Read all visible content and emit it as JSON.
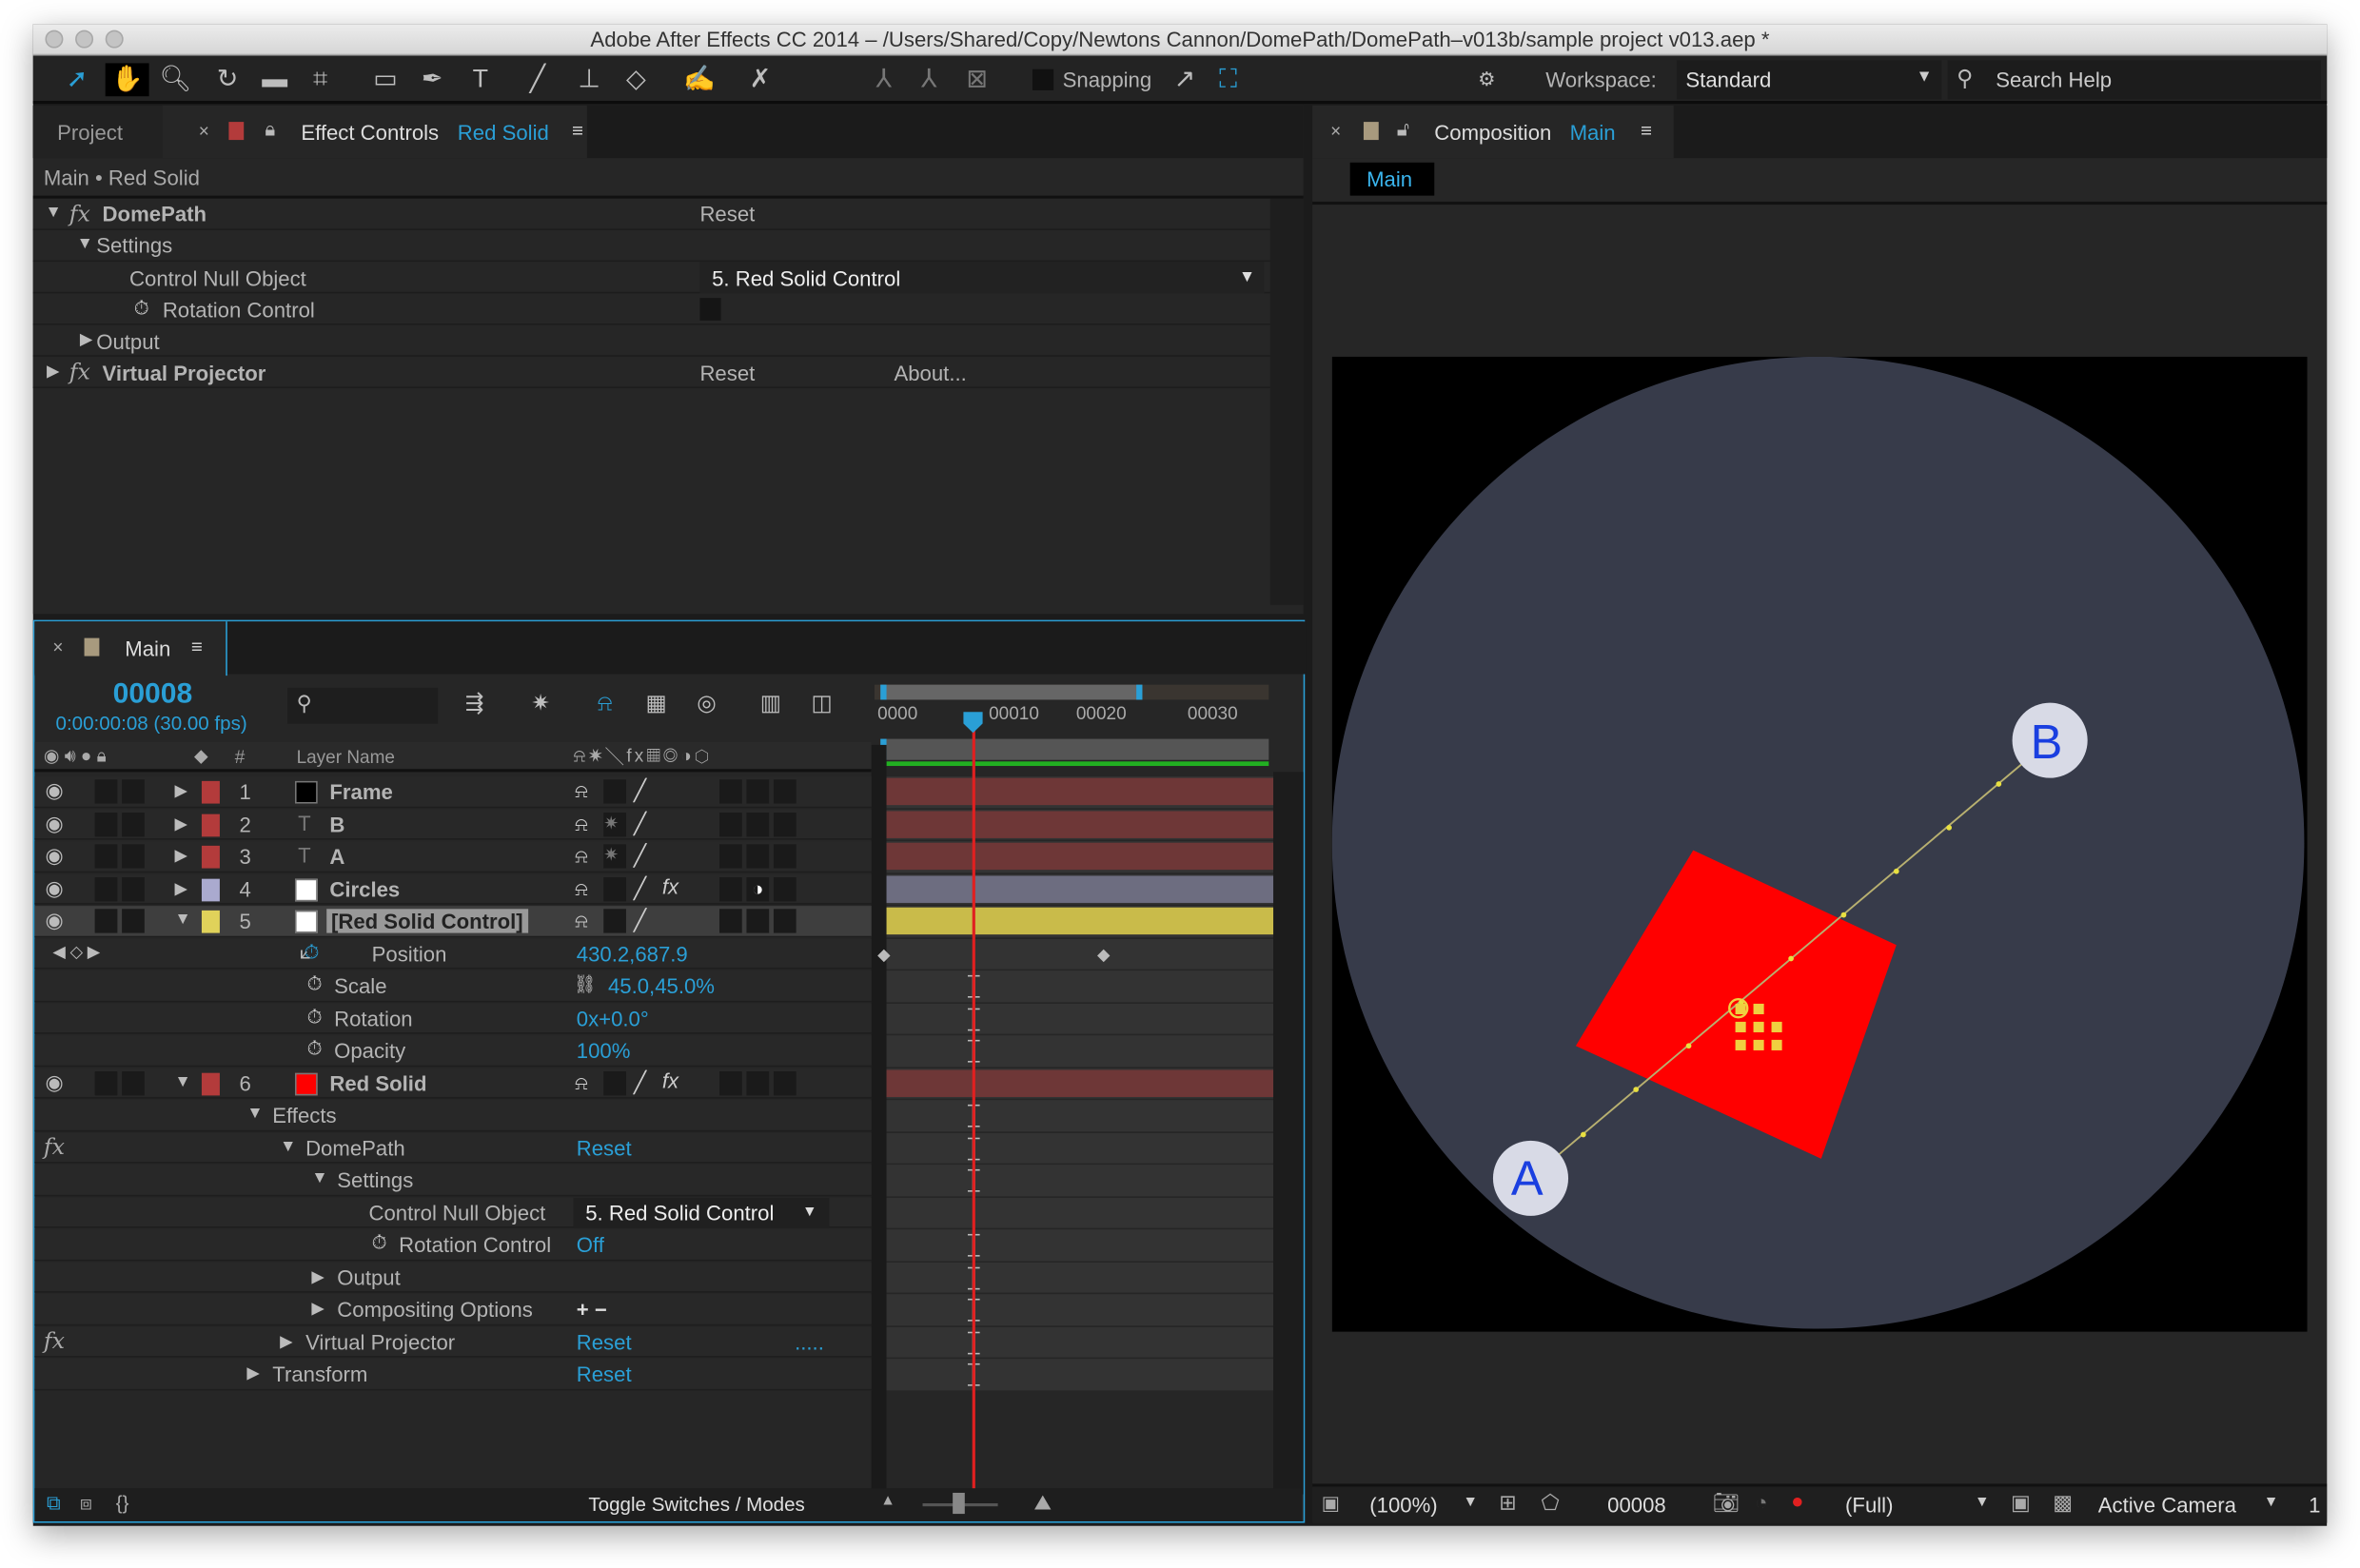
{
  "window": {
    "title": "Adobe After Effects CC 2014 – /Users/Shared/Copy/Newtons Cannon/DomePath/DomePath–v013b/sample project v013.aep *"
  },
  "toolbar": {
    "snapping": "Snapping",
    "workspace_label": "Workspace:",
    "workspace_value": "Standard",
    "search_placeholder": "Search Help"
  },
  "effect_controls": {
    "tab_project": "Project",
    "tab_title": "Effect Controls",
    "tab_layer": "Red Solid",
    "breadcrumb": "Main • Red Solid",
    "domepath": {
      "name": "DomePath",
      "reset": "Reset",
      "settings": "Settings",
      "control_null_label": "Control Null Object",
      "control_null_value": "5. Red Solid Control",
      "rotation_control": "Rotation Control",
      "output": "Output"
    },
    "virtual_projector": {
      "name": "Virtual Projector",
      "reset": "Reset",
      "about": "About..."
    }
  },
  "timeline": {
    "tab": "Main",
    "current_frame": "00008",
    "timecode": "0:00:00:08 (30.00 fps)",
    "column_number": "#",
    "column_layer_name": "Layer Name",
    "ruler": [
      "0000",
      "00010",
      "00020",
      "00030"
    ],
    "playhead_frame": 8,
    "toggle": "Toggle Switches / Modes",
    "rows": [
      {
        "type": "layer",
        "num": "1",
        "name": "Frame",
        "label": "#b33b3b",
        "src": "#000000",
        "bar": "#6e3737",
        "switches": [
          "shy",
          "",
          "pen"
        ],
        "fx": false
      },
      {
        "type": "layer",
        "num": "2",
        "name": "B",
        "label": "#b33b3b",
        "src": "text",
        "bar": "#6e3737",
        "switches": [
          "shy",
          "star",
          "pen"
        ],
        "fx": false
      },
      {
        "type": "layer",
        "num": "3",
        "name": "A",
        "label": "#b33b3b",
        "src": "text",
        "bar": "#6e3737",
        "switches": [
          "shy",
          "star",
          "pen"
        ],
        "fx": false
      },
      {
        "type": "layer",
        "num": "4",
        "name": "Circles",
        "label": "#aaaacf",
        "src": "#ffffff",
        "bar": "#6d6d80",
        "switches": [
          "shy",
          "",
          "pen"
        ],
        "fx": true,
        "mode": true
      },
      {
        "type": "layer",
        "num": "5",
        "name": "[Red Solid Control]",
        "label": "#e0d25a",
        "src": "#ffffff",
        "bar": "#c9bb4a",
        "switches": [
          "shy",
          "",
          "pen"
        ],
        "fx": false,
        "open": true,
        "selected": true
      },
      {
        "type": "prop",
        "name": "Position",
        "value": "430.2,687.9",
        "indent": 224,
        "stopwatch": true,
        "active": true,
        "keys": true
      },
      {
        "type": "prop",
        "name": "Scale",
        "value": "45.0,45.0%",
        "indent": 199,
        "stopwatch": true,
        "link": true
      },
      {
        "type": "prop",
        "name": "Rotation",
        "value": "0x+0.0°",
        "indent": 199,
        "stopwatch": true
      },
      {
        "type": "prop",
        "name": "Opacity",
        "value": "100%",
        "indent": 199,
        "stopwatch": true
      },
      {
        "type": "layer",
        "num": "6",
        "name": "Red Solid",
        "label": "#b33b3b",
        "src": "#ff0000",
        "bar": "#6e3737",
        "switches": [
          "shy",
          "",
          "pen"
        ],
        "fx": true,
        "open": true
      },
      {
        "type": "group",
        "name": "Effects",
        "indent": 158,
        "twirl": "open"
      },
      {
        "type": "group",
        "name": "DomePath",
        "indent": 180,
        "twirl": "open",
        "fx": true,
        "value": "Reset"
      },
      {
        "type": "group",
        "name": "Settings",
        "indent": 201,
        "twirl": "open"
      },
      {
        "type": "prop",
        "name": "Control Null Object",
        "indent": 222,
        "value": "5. Red Solid Control",
        "dropdown": true,
        "noibeam": true
      },
      {
        "type": "prop",
        "name": "Rotation Control",
        "indent": 242,
        "stopwatch": true,
        "value": "Off"
      },
      {
        "type": "group",
        "name": "Output",
        "indent": 201,
        "twirl": "closed"
      },
      {
        "type": "group",
        "name": "Compositing Options",
        "indent": 201,
        "twirl": "closed",
        "value": "+ −",
        "plain": true
      },
      {
        "type": "group",
        "name": "Virtual Projector",
        "indent": 180,
        "twirl": "closed",
        "fx": true,
        "value": "Reset",
        "dots": "....."
      },
      {
        "type": "group",
        "name": "Transform",
        "indent": 158,
        "twirl": "closed",
        "value": "Reset"
      }
    ]
  },
  "composition": {
    "tab_title": "Composition",
    "tab_comp": "Main",
    "breadcrumb": "Main",
    "point_a": "A",
    "point_b": "B",
    "zoom": "(100%)",
    "frame": "00008",
    "resolution": "(Full)",
    "camera": "Active Camera",
    "views": "1"
  },
  "colors": {
    "accent": "#2a9fd6",
    "dome": "#373b4a",
    "solid": "#ff0000",
    "playhead": "#e02020"
  }
}
